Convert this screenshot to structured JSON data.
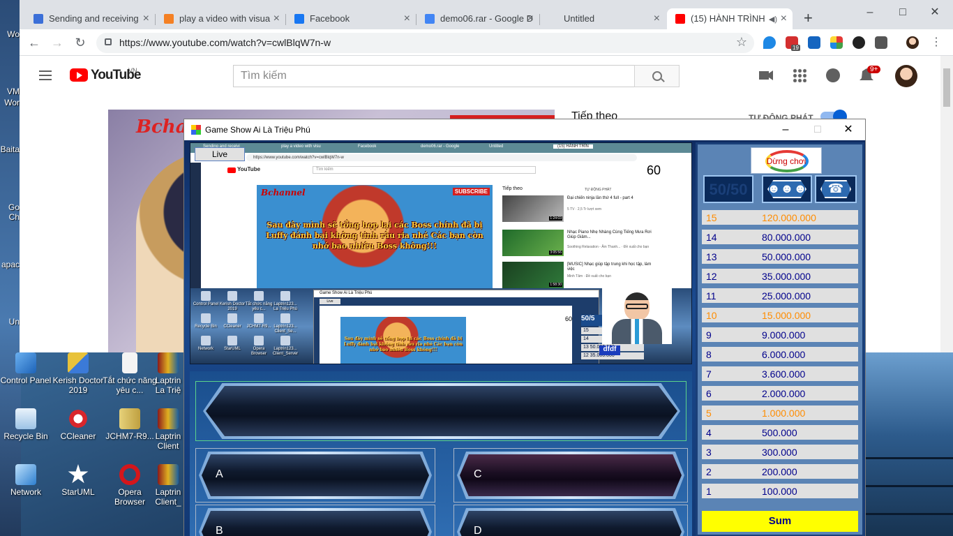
{
  "desktop": {
    "left_strip": [
      "Wo",
      "VM",
      "Wor",
      "Baita",
      "Go",
      "Ch",
      "apac",
      "Un"
    ],
    "icons": [
      {
        "label": "Control Panel",
        "icon": "control-panel-icon"
      },
      {
        "label": "Kerish Doctor 2019",
        "icon": "kerish-doctor-icon"
      },
      {
        "label": "Tắt chức năng yêu c...",
        "icon": "document-icon"
      },
      {
        "label": "Laptrin La Triệ",
        "icon": "archive-icon"
      },
      {
        "label": "Recycle Bin",
        "icon": "recycle-bin-icon"
      },
      {
        "label": "CCleaner",
        "icon": "ccleaner-icon"
      },
      {
        "label": "JCHM7-R9...",
        "icon": "zip-icon"
      },
      {
        "label": "Laptrin Client",
        "icon": "archive-icon"
      },
      {
        "label": "Network",
        "icon": "network-icon"
      },
      {
        "label": "StarUML",
        "icon": "staruml-icon"
      },
      {
        "label": "Opera Browser",
        "icon": "opera-icon"
      },
      {
        "label": "Laptrin Client_",
        "icon": "archive-icon"
      }
    ]
  },
  "chrome": {
    "tabs": [
      {
        "title": "Sending and receiving",
        "color": "#3b6fd8"
      },
      {
        "title": "play a video with visua",
        "color": "#f48024"
      },
      {
        "title": "Facebook",
        "color": "#1877f2"
      },
      {
        "title": "demo06.rar - Google D",
        "color": "#4285f4"
      },
      {
        "title": "Untitled",
        "color": "#dee1e6"
      },
      {
        "title": "(15) HÀNH TRÌNH",
        "color": "#ff0000"
      }
    ],
    "url": "https://www.youtube.com/watch?v=cwlBlqW7n-w",
    "ext_badge": "19"
  },
  "youtube": {
    "logo_text": "YouTube",
    "country": "VN",
    "search_placeholder": "Tìm kiếm",
    "notification_count": "9+",
    "up_next": "Tiếp theo",
    "autoplay": "TỰ ĐỘNG PHÁT",
    "channel_watermark": "Bchannel"
  },
  "game": {
    "title": "Game Show Ai Là Triệu Phú",
    "live_button": "Live",
    "timer": "60",
    "stop_button": "Dừng chơi",
    "lifeline_5050": "50/50",
    "answers": [
      "A",
      "C",
      "B",
      "D"
    ],
    "prize_ladder": [
      {
        "level": "15",
        "amount": "120.000.000",
        "milestone": true
      },
      {
        "level": "14",
        "amount": "80.000.000",
        "milestone": false
      },
      {
        "level": "13",
        "amount": "50.000.000",
        "milestone": false
      },
      {
        "level": "12",
        "amount": "35.000.000",
        "milestone": false
      },
      {
        "level": "11",
        "amount": "25.000.000",
        "milestone": false
      },
      {
        "level": "10",
        "amount": "15.000.000",
        "milestone": true
      },
      {
        "level": "9",
        "amount": "9.000.000",
        "milestone": false
      },
      {
        "level": "8",
        "amount": "6.000.000",
        "milestone": false
      },
      {
        "level": "7",
        "amount": "3.600.000",
        "milestone": false
      },
      {
        "level": "6",
        "amount": "2.000.000",
        "milestone": false
      },
      {
        "level": "5",
        "amount": "1.000.000",
        "milestone": true
      },
      {
        "level": "4",
        "amount": "500.000",
        "milestone": false
      },
      {
        "level": "3",
        "amount": "300.000",
        "milestone": false
      },
      {
        "level": "2",
        "amount": "200.000",
        "milestone": false
      },
      {
        "level": "1",
        "amount": "100.000",
        "milestone": false
      }
    ],
    "sum_button": "Sum",
    "stream": {
      "subscribe": "SUBSCRIBE",
      "caption": "Sau đây mình sẽ tổng hợp lại các Boss chính đã bị Luffy đánh bại không tính râu ria nhé Các bạn còn nhớ bao nhiêu Boss không!!!",
      "side_title": "Tiếp theo",
      "autoplay": "TỰ ĐỘNG PHÁT",
      "videos": [
        {
          "title": "Đại chiến ninja lần thứ 4 full - part 4",
          "meta": "5 TV · 2,5 Tr lượt xem",
          "duration": "1:24:03"
        },
        {
          "title": "Nhạc Piano Nhẹ Nhàng Cùng Tiếng Mưa Rơi Giúp Giảm...",
          "meta": "Soothing Relaxation - Âm Thanh... · Đề xuất cho bạn",
          "duration": "3:05:56"
        },
        {
          "title": "[MUSIC] Nhạc giúp tập trung khi học tập, làm việc",
          "meta": "Minh Tâm · Đề xuất cho bạn",
          "duration": "1:58:30"
        }
      ],
      "mini_tabs": [
        "Sending and receivi",
        "play a video with visu",
        "Facebook",
        "demo06.rar - Google",
        "Untitled",
        "(15) HÀNH TRÌN"
      ],
      "mini_url": "https://www.youtube.com/watch?v=cwlBlqW7n-w",
      "mini_desktop_icons": [
        "Control Panel",
        "Kerish Doctor 2019",
        "Tắt chức năng yêu c...",
        "Laptrin123... La Triệu Phú",
        "Recycle Bin",
        "CCleaner",
        "JCHM7-R9...",
        "Laptrin123... Client_Se...",
        "Network",
        "StarUML",
        "Opera Browser",
        "Laptrin123... Client_Server"
      ],
      "nested_title": "Game Show Ai Là Triệu Phú",
      "nested_live": "Live",
      "nested_timer": "60",
      "mini_5050": "50/5",
      "dfdf": "dfdf",
      "mini_prizes": [
        {
          "level": "15",
          "amount": ""
        },
        {
          "level": "14",
          "amount": ""
        },
        {
          "level": "13",
          "amount": "50.000.000"
        },
        {
          "level": "12",
          "amount": "35.000.000"
        }
      ]
    }
  }
}
